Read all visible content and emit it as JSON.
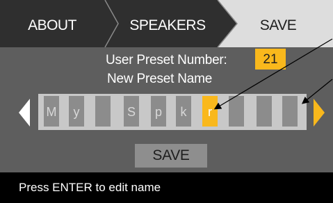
{
  "tabs": [
    {
      "label": "ABOUT",
      "active": false
    },
    {
      "label": "SPEAKERS",
      "active": false
    },
    {
      "label": "SAVE",
      "active": true
    }
  ],
  "preset": {
    "number_label": "User Preset Number:",
    "number": "21",
    "name_label": "New Preset Name"
  },
  "name_chars": [
    "M",
    "y",
    "",
    "S",
    "p",
    "k",
    "r",
    "",
    "",
    ""
  ],
  "selected_char_index": 6,
  "save_button": "SAVE",
  "status": "Press ENTER to edit name",
  "icons": {
    "left_arrow": "left-arrow-icon",
    "right_arrow": "right-arrow-icon",
    "callout_arrows": "callout-arrow-icon"
  },
  "colors": {
    "background": "#5e5e5e",
    "tab_dark": "#2f2f2f",
    "tab_active": "#dddddd",
    "accent": "#f9b81c",
    "char_box": "#8c8c8c",
    "name_frame": "#c8c8c8",
    "status_bar": "#000000"
  }
}
